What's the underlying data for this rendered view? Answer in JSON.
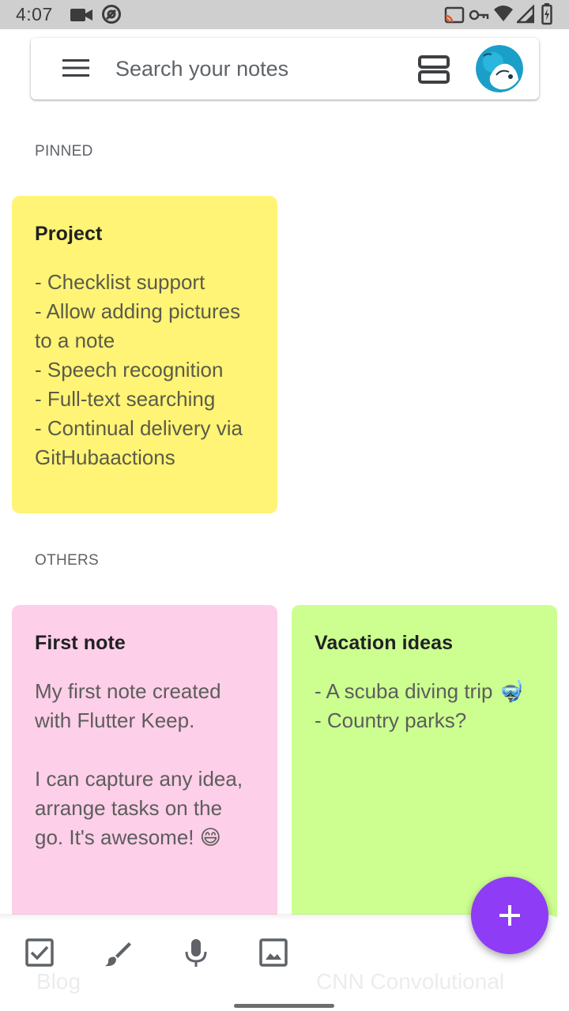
{
  "status_bar": {
    "time": "4:07",
    "left_icons": [
      "video-camera-icon",
      "at-sign-icon"
    ],
    "right_icons": [
      "cast-icon",
      "vpn-key-icon",
      "wifi-icon",
      "signal-icon",
      "battery-icon"
    ]
  },
  "search": {
    "placeholder": "Search your notes",
    "menu_icon": "menu-icon",
    "view_toggle_icon": "view-agenda-icon",
    "avatar_icon": "avatar"
  },
  "sections": {
    "pinned_label": "PINNED",
    "others_label": "OTHERS"
  },
  "notes": {
    "pinned": [
      {
        "title": "Project",
        "body": "- Checklist support\n- Allow adding pictures to a note\n- Speech recognition\n- Full-text searching\n- Continual delivery via GitHubaactions",
        "color": "#fff475"
      }
    ],
    "others": [
      {
        "title": "First note",
        "body": "My first note created with Flutter Keep.\n\nI can capture any idea, arrange tasks on the go. It's awesome! 😄",
        "color": "#fdcfe8"
      },
      {
        "title": "Vacation ideas",
        "body": "- A scuba diving trip 🤿\n- Country parks?",
        "color": "#ccff90"
      }
    ]
  },
  "bottom_bar": {
    "tools": [
      "checkbox-icon",
      "brush-icon",
      "mic-icon",
      "image-icon"
    ],
    "ghost_left": "Blog",
    "ghost_right": "CNN Convolutional"
  },
  "fab": {
    "icon": "plus-icon",
    "color": "#8e3cf5"
  },
  "colors": {
    "accent": "#8e3cf5",
    "status_bar": "#cfcfcf"
  }
}
